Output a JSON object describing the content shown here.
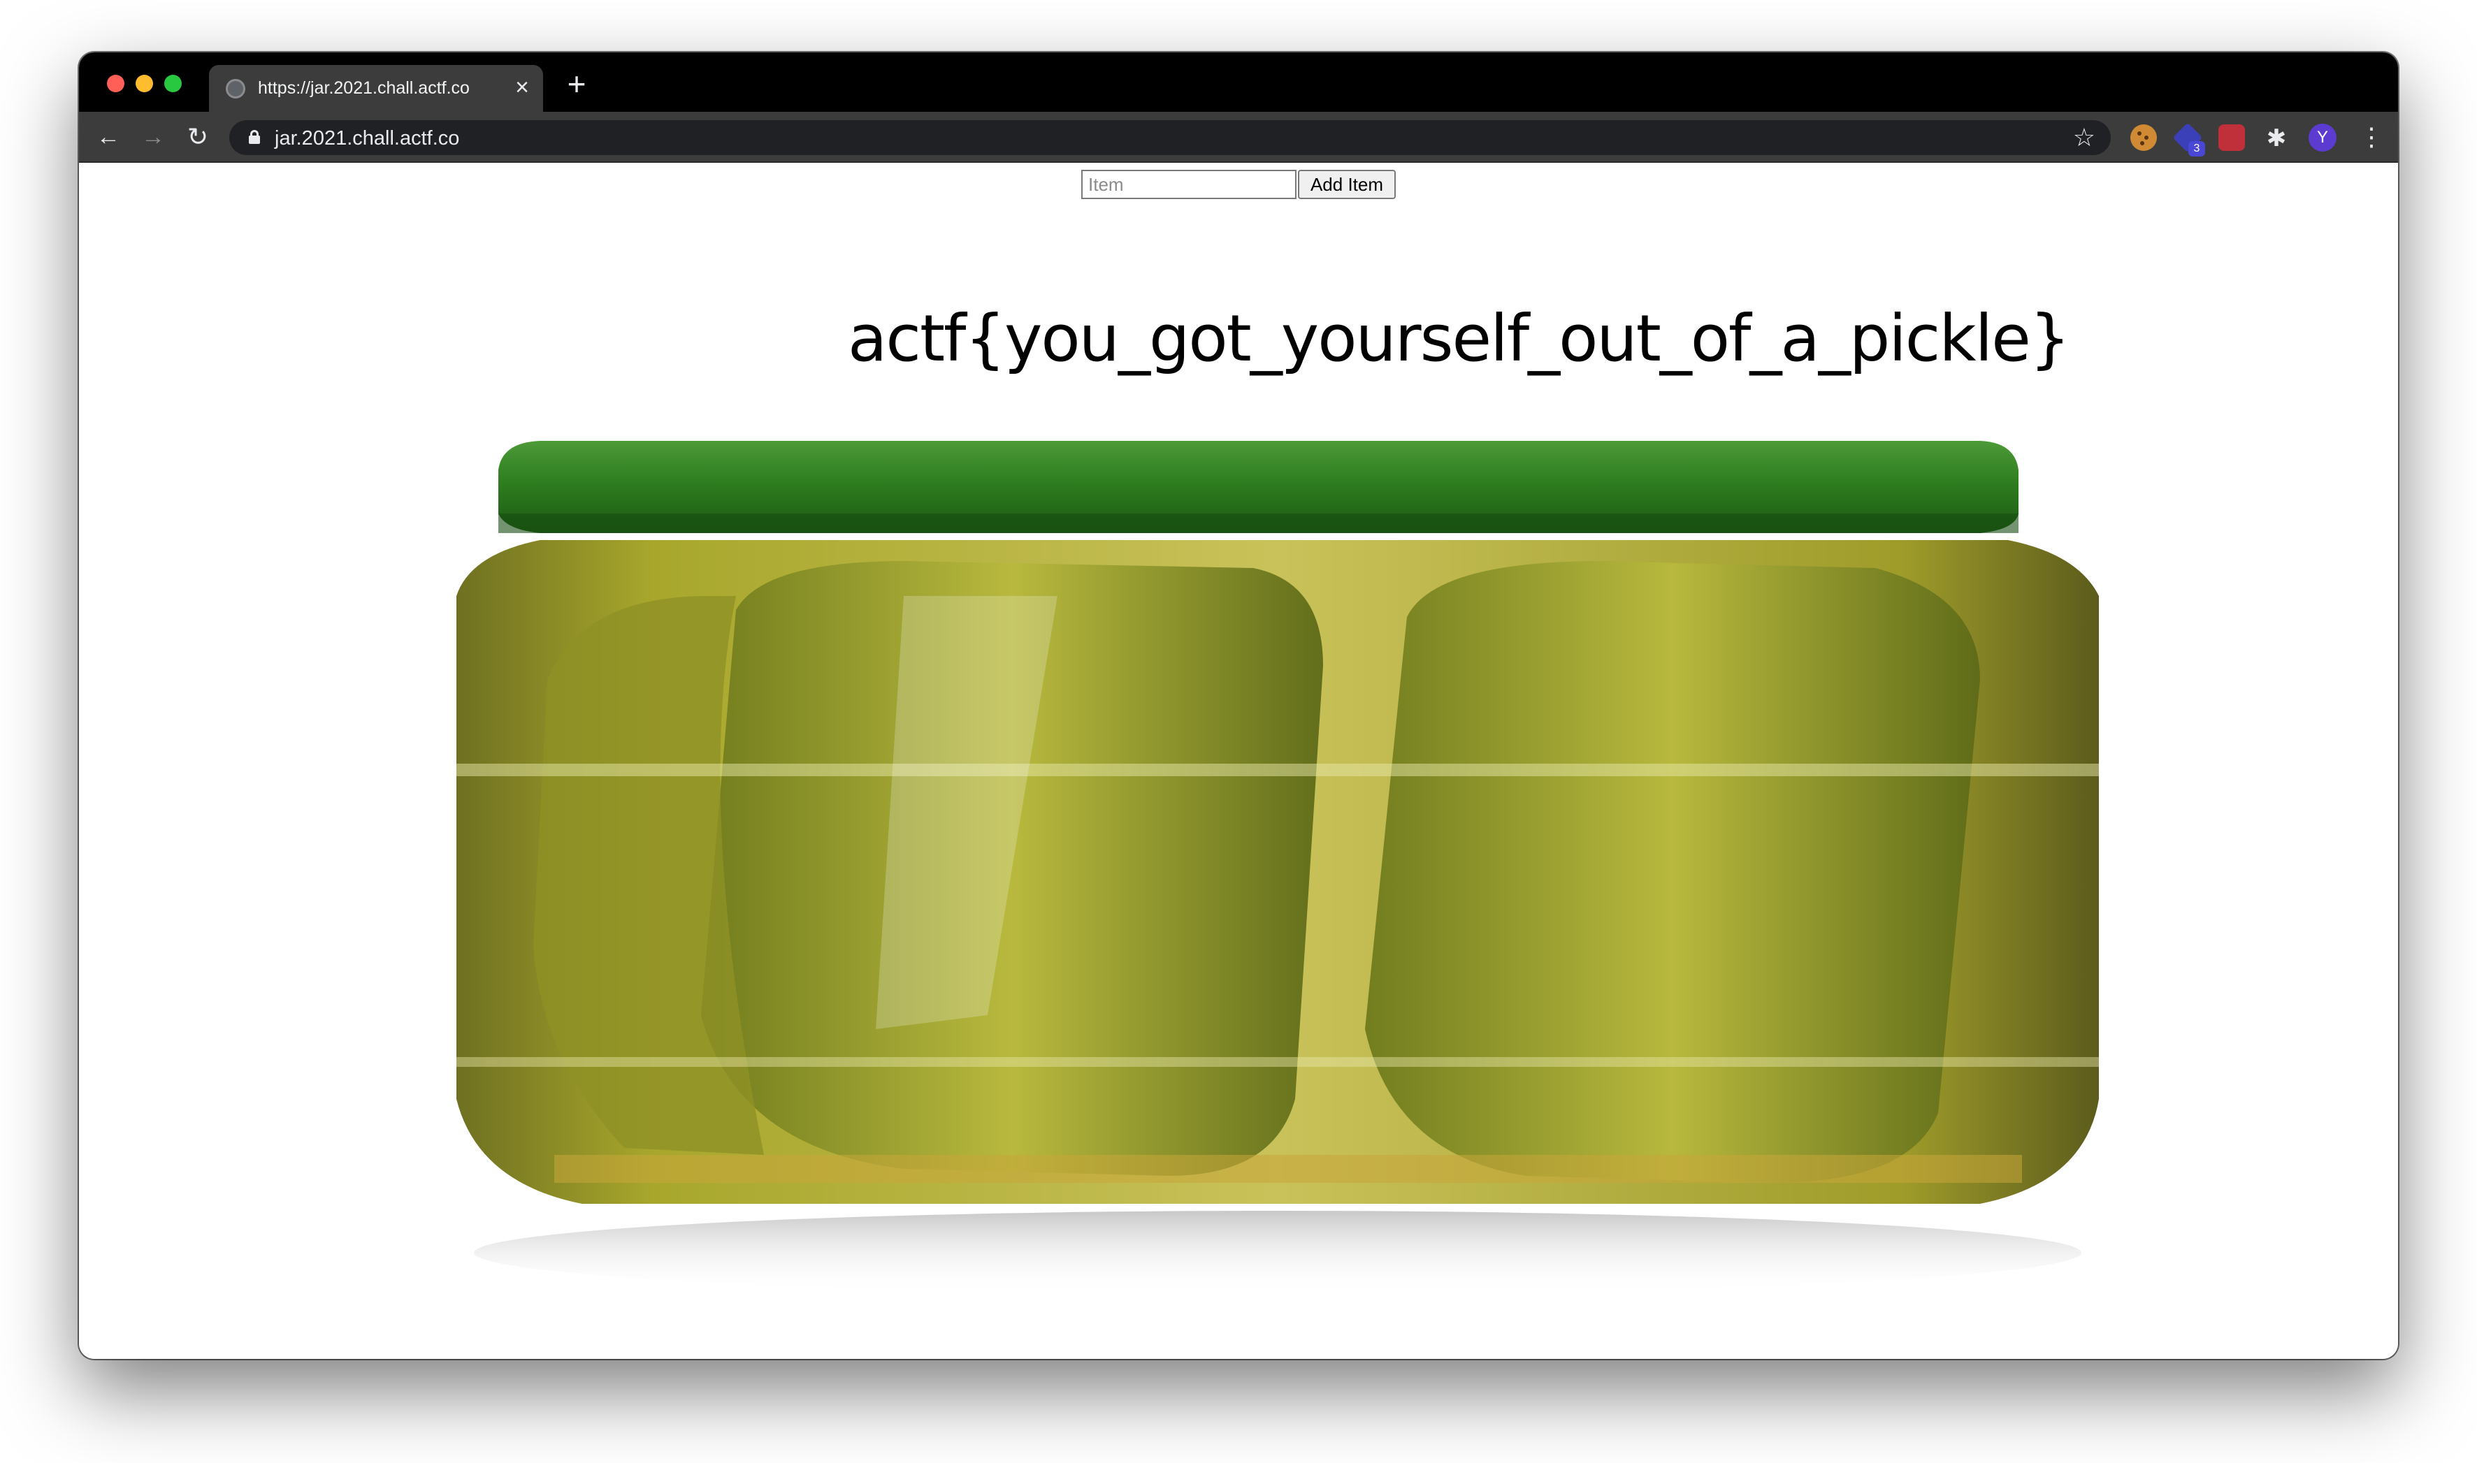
{
  "browser": {
    "tab_title": "https://jar.2021.chall.actf.co",
    "tab_close_icon": "×",
    "new_tab_icon": "+",
    "address": "jar.2021.chall.actf.co",
    "back_icon": "←",
    "forward_icon": "→",
    "reload_icon": "↻",
    "star_icon": "☆",
    "puzzle_icon": "✱",
    "menu_icon": "⋮",
    "extension_badge": "3",
    "profile_initial": "Y"
  },
  "page": {
    "item_placeholder": "Item",
    "add_button_label": "Add Item",
    "flag_text": "actf{you_got_yourself_out_of_a_pickle}"
  },
  "colors": {
    "lid_green": "#2e7d1f",
    "pickle_green": "#a8a72c",
    "brine": "#c9c25a"
  }
}
